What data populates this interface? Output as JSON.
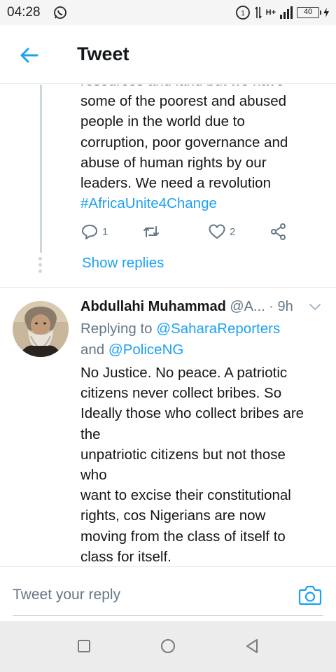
{
  "status_bar": {
    "time": "04:28",
    "network": "H+",
    "battery": "40"
  },
  "header": {
    "title": "Tweet"
  },
  "previous_tweet": {
    "text_lines": [
      "resources and land but we have",
      "some of the poorest and abused",
      "people in the world due to",
      "corruption, poor governance and",
      "abuse of human rights by our",
      "leaders. We need a revolution"
    ],
    "hashtag": "#AfricaUnite4Change",
    "reply_count": "1",
    "like_count": "2",
    "show_replies": "Show replies"
  },
  "reply_tweet": {
    "name": "Abdullahi Muhammad",
    "handle": "@A...",
    "time": "· 9h",
    "replying_prefix": "Replying to",
    "mention_1": "@SaharaReporters",
    "and_word": "and",
    "mention_2": "@PoliceNG",
    "body": "No Justice. No peace. A patriotic\ncitizens never collect bribes. So\nIdeally those who collect bribes are\nthe\nunpatriotic citizens but not those\nwho\nwant to excise their constitutional\nrights, cos Nigerians are now\nmoving from the class of itself to\nclass for itself."
  },
  "reply_bar": {
    "placeholder": "Tweet your reply"
  },
  "icons": {
    "back": "back-arrow-icon",
    "reply": "reply-icon",
    "retweet": "retweet-icon",
    "like": "heart-icon",
    "share": "share-icon",
    "camera": "camera-icon"
  },
  "colors": {
    "accent": "#1da1f2",
    "secondary_text": "#657786",
    "divider": "#e6ecf0"
  }
}
